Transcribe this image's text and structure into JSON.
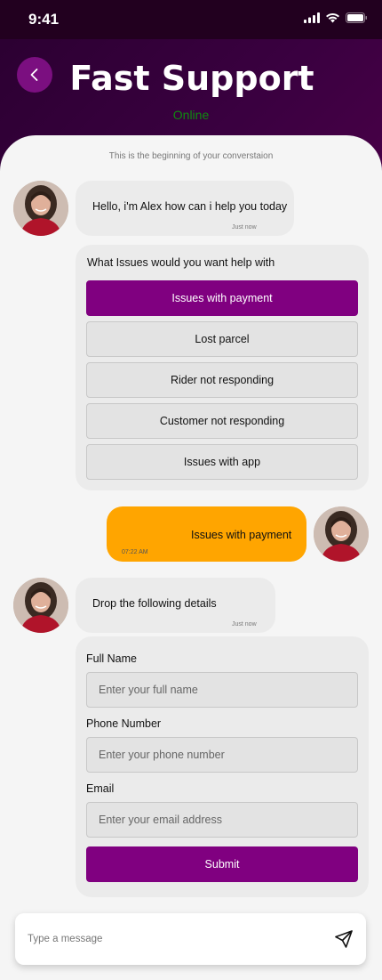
{
  "status_bar": {
    "time": "9:41"
  },
  "header": {
    "title": "Fast Support",
    "status": "Online"
  },
  "chat": {
    "beginning_note": "This is the beginning of your converstaion",
    "messages": [
      {
        "text": "Hello, i'm Alex how can i help you today",
        "time": "Just now"
      },
      {
        "text": "Issues with payment",
        "time": "07:22 AM"
      },
      {
        "text": "Drop the following details",
        "time": "Just now"
      }
    ]
  },
  "options": {
    "title": "What Issues would you want help with",
    "items": [
      {
        "label": "Issues with payment",
        "selected": true
      },
      {
        "label": "Lost parcel",
        "selected": false
      },
      {
        "label": "Rider not responding",
        "selected": false
      },
      {
        "label": "Customer not responding",
        "selected": false
      },
      {
        "label": "Issues with app",
        "selected": false
      }
    ]
  },
  "form": {
    "fields": [
      {
        "label": "Full Name",
        "placeholder": "Enter your full name"
      },
      {
        "label": "Phone Number",
        "placeholder": "Enter your phone number"
      },
      {
        "label": "Email",
        "placeholder": "Enter your email address"
      }
    ],
    "submit_label": "Submit"
  },
  "composer": {
    "placeholder": "Type a message"
  },
  "colors": {
    "accent": "#800080",
    "user_bubble": "#ffa500",
    "online": "#0f8a0f",
    "header_bg": "#2a0030"
  },
  "icons": {
    "back": "chevron-left-icon",
    "send": "send-icon",
    "signal": "signal-icon",
    "wifi": "wifi-icon",
    "battery": "battery-icon"
  }
}
